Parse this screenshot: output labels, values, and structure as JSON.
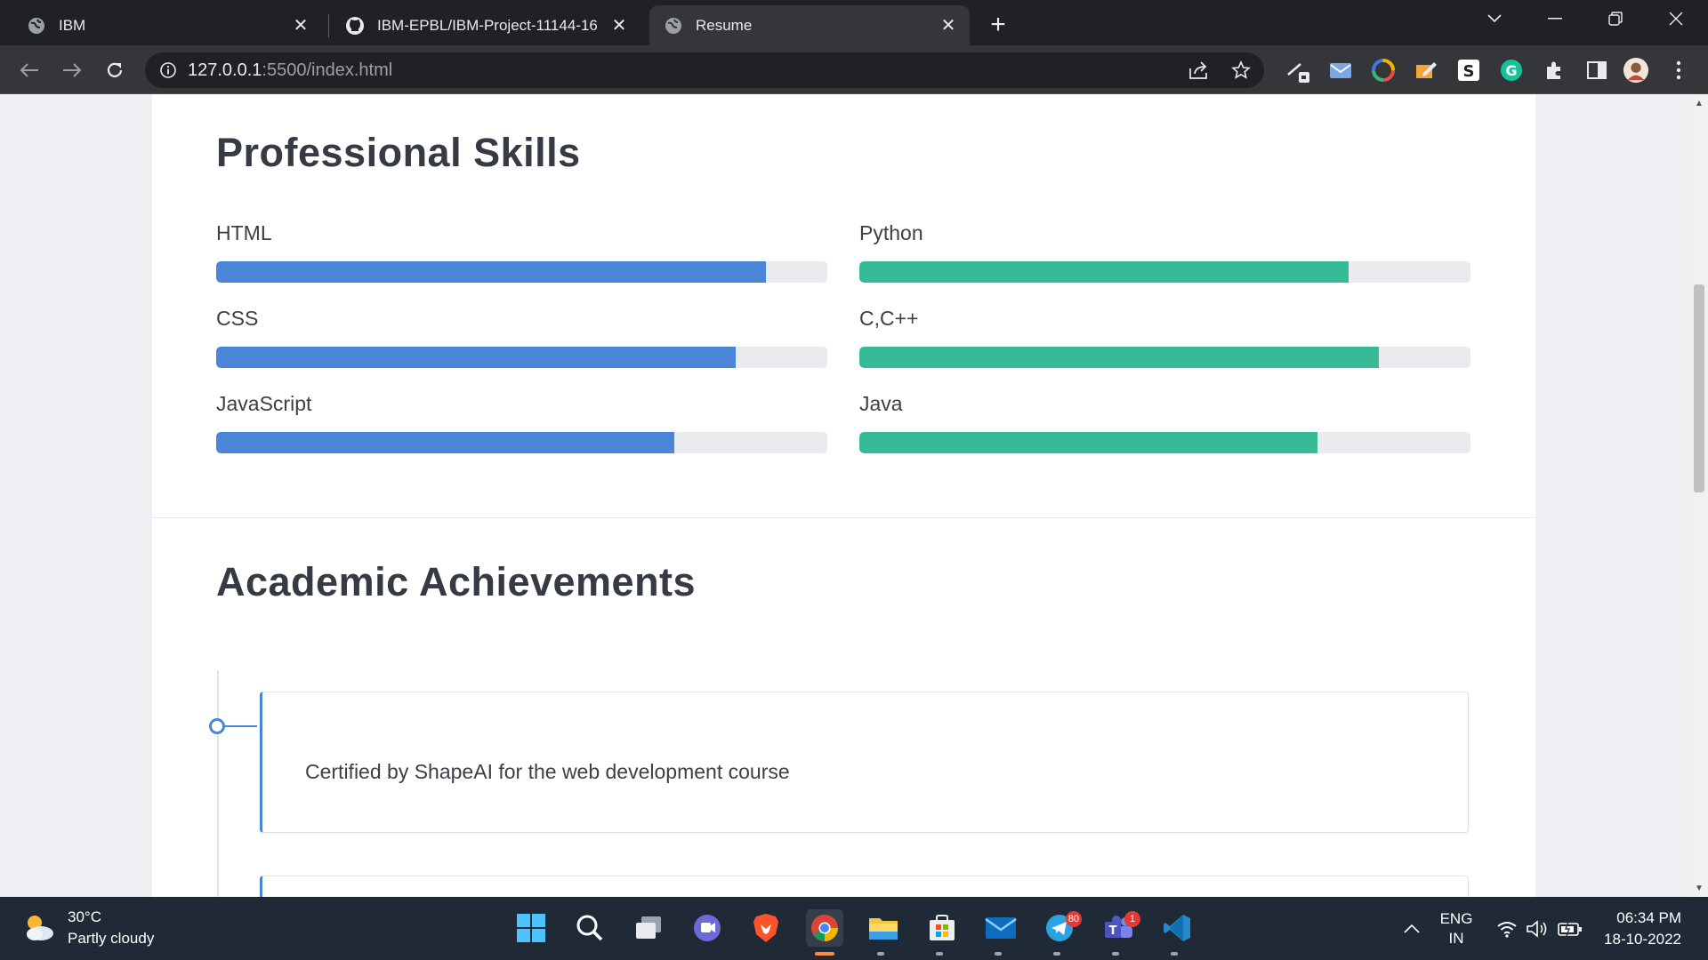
{
  "browser": {
    "tabs": [
      {
        "title": "IBM",
        "icon": "globe-icon",
        "active": false
      },
      {
        "title": "IBM-EPBL/IBM-Project-11144-16",
        "icon": "github-icon",
        "active": false
      },
      {
        "title": "Resume",
        "icon": "globe-icon",
        "active": true
      }
    ],
    "url_host": "127.0.0.1",
    "url_path": ":5500/index.html"
  },
  "page": {
    "skills_title": "Professional Skills",
    "skills_left": [
      {
        "label": "HTML",
        "percent": 90
      },
      {
        "label": "CSS",
        "percent": 85
      },
      {
        "label": "JavaScript",
        "percent": 75
      }
    ],
    "skills_right": [
      {
        "label": "Python",
        "percent": 80
      },
      {
        "label": "C,C++",
        "percent": 85
      },
      {
        "label": "Java",
        "percent": 75
      }
    ],
    "left_bar_color": "#4a86d8",
    "right_bar_color": "#36bb96",
    "achievements_title": "Academic Achievements",
    "achievements": [
      {
        "text": "Certified by ShapeAI for the web development course"
      },
      {
        "text": ""
      }
    ]
  },
  "taskbar": {
    "temperature": "30°C",
    "weather": "Partly cloudy",
    "lang_top": "ENG",
    "lang_bottom": "IN",
    "time": "06:34 PM",
    "date": "18-10-2022",
    "telegram_badge": "80",
    "teams_badge": "1"
  }
}
